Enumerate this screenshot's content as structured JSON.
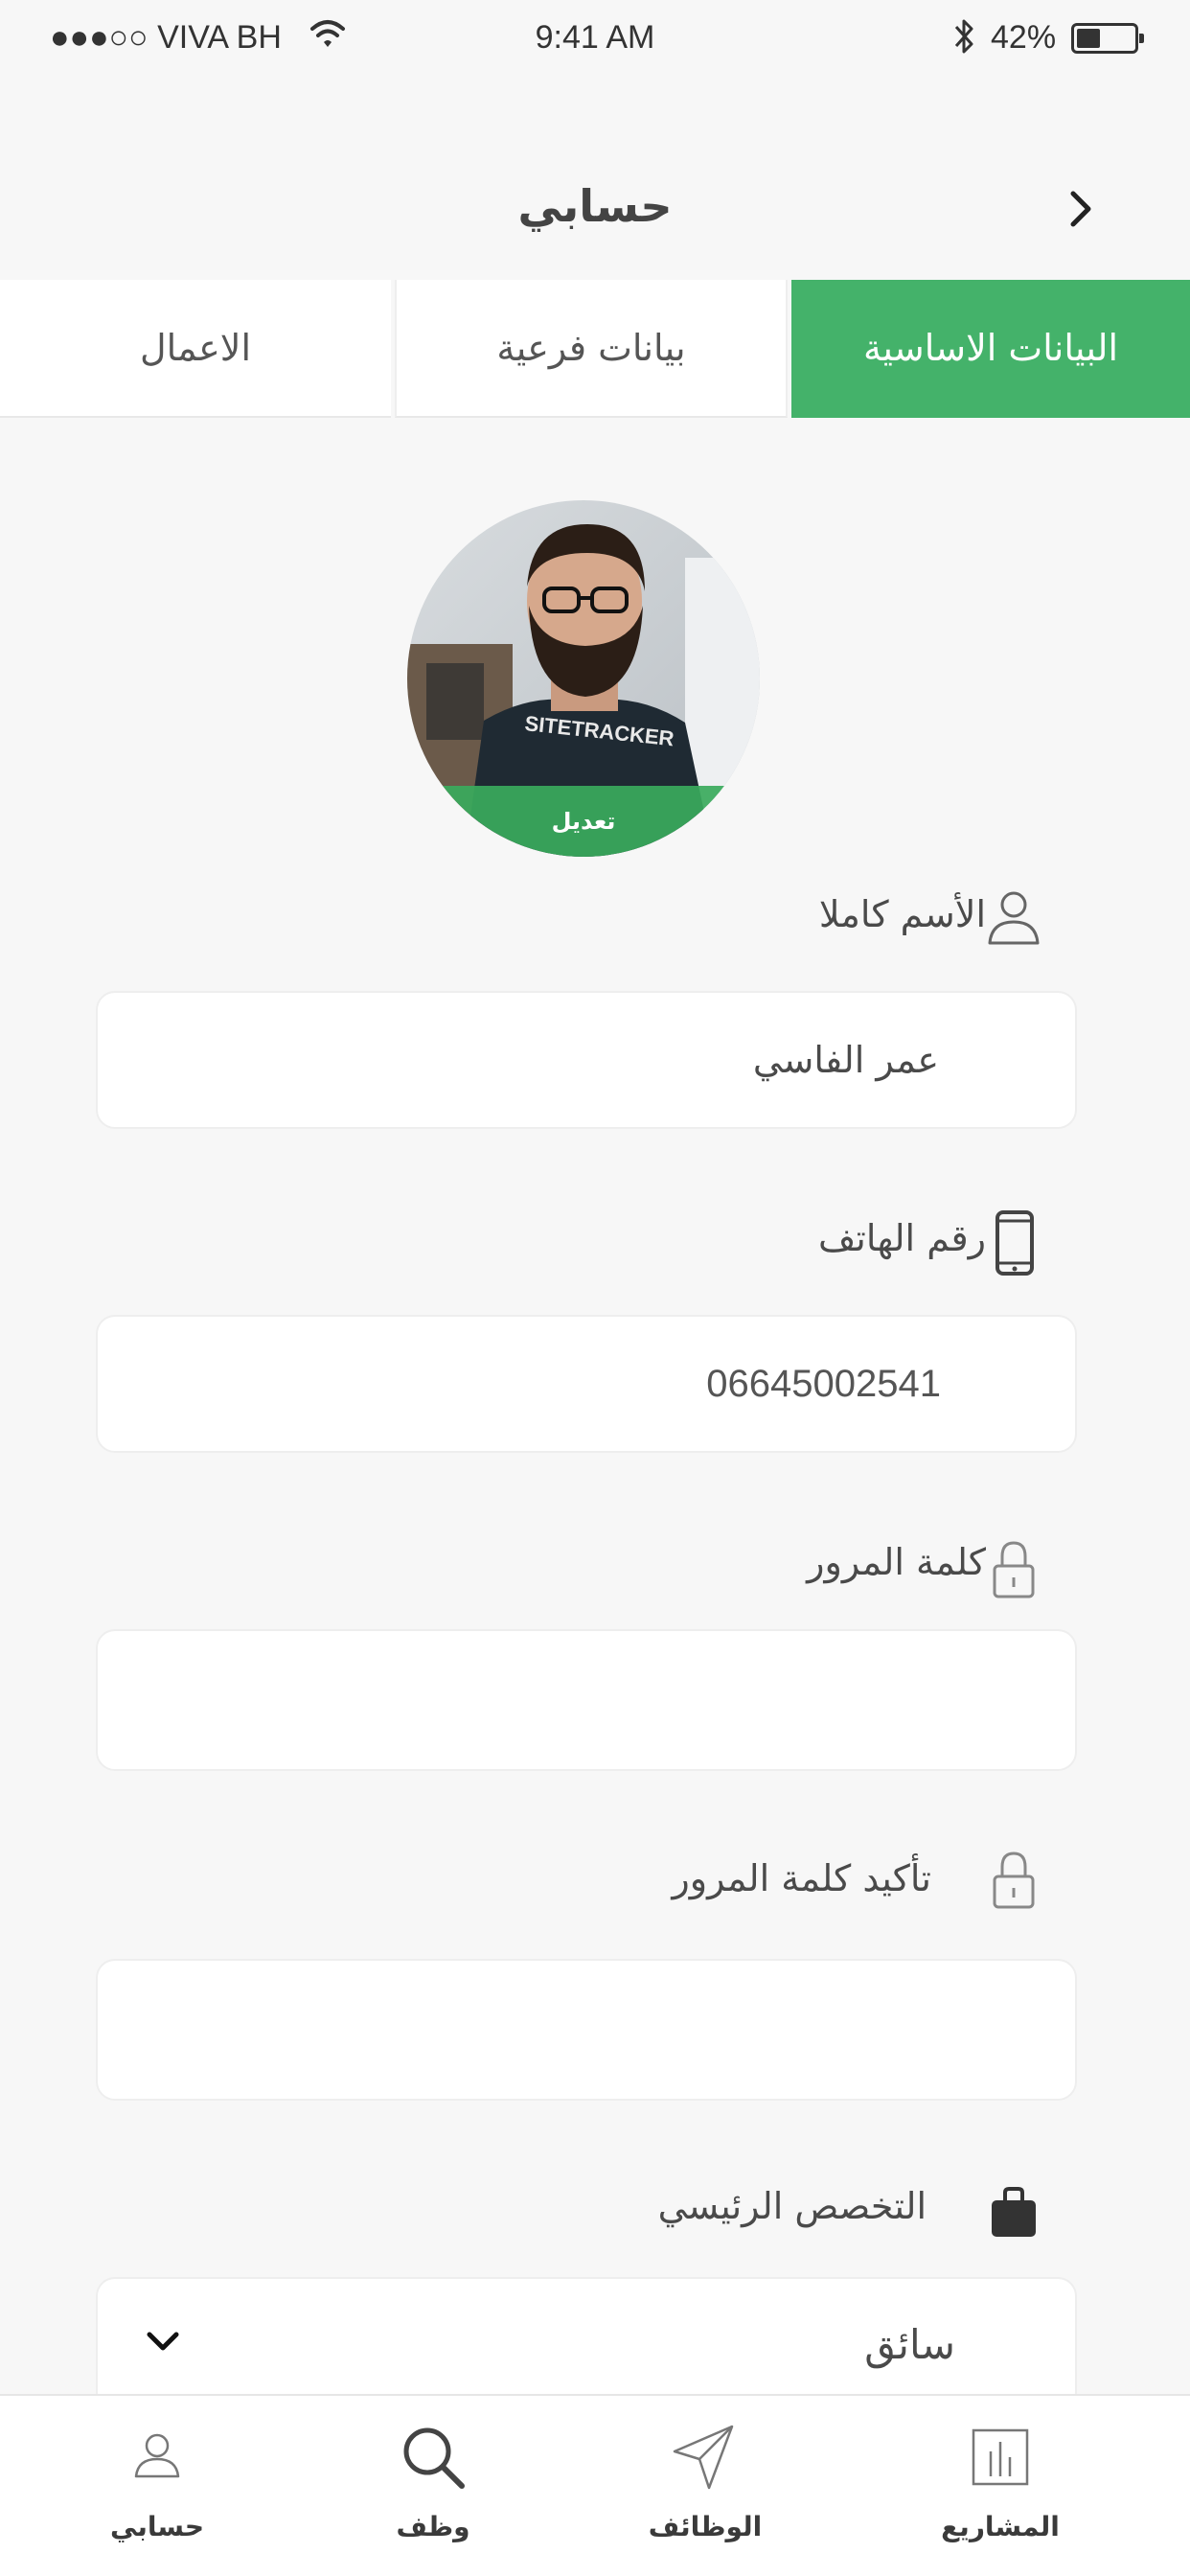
{
  "status_bar": {
    "carrier": "●●●○○ VIVA BH",
    "time": "9:41 AM",
    "battery": "42%",
    "battery_level": 0.42
  },
  "header": {
    "title": "حسابي",
    "back_icon": "chevron-right-icon"
  },
  "tabs": [
    {
      "label": "البيانات الاساسية",
      "active": true
    },
    {
      "label": "بيانات فرعية",
      "active": false
    },
    {
      "label": "الاعمال",
      "active": false
    }
  ],
  "profile": {
    "edit_label": "تعديل",
    "shirt_text": "SITETRACKER"
  },
  "form": {
    "full_name": {
      "label": "الأسم كاملا",
      "value": "عمر الفاسي",
      "icon": "user-icon"
    },
    "phone": {
      "label": "رقم الهاتف",
      "value": "06645002541",
      "icon": "phone-icon"
    },
    "password": {
      "label": "كلمة المرور",
      "value": "",
      "icon": "lock-icon"
    },
    "confirm_password": {
      "label": "تأكيد كلمة المرور",
      "value": "",
      "icon": "lock-icon"
    },
    "specialty": {
      "label": "التخصص الرئيسي",
      "value": "سائق",
      "icon": "briefcase-icon"
    }
  },
  "bottom_nav": [
    {
      "label": "المشاريع",
      "icon": "chart-icon"
    },
    {
      "label": "الوظائف",
      "icon": "send-icon"
    },
    {
      "label": "وظف",
      "icon": "search-icon"
    },
    {
      "label": "حسابي",
      "icon": "user-icon"
    }
  ],
  "colors": {
    "accent": "#44b26a",
    "background": "#f7f7f7",
    "text": "#444444"
  }
}
